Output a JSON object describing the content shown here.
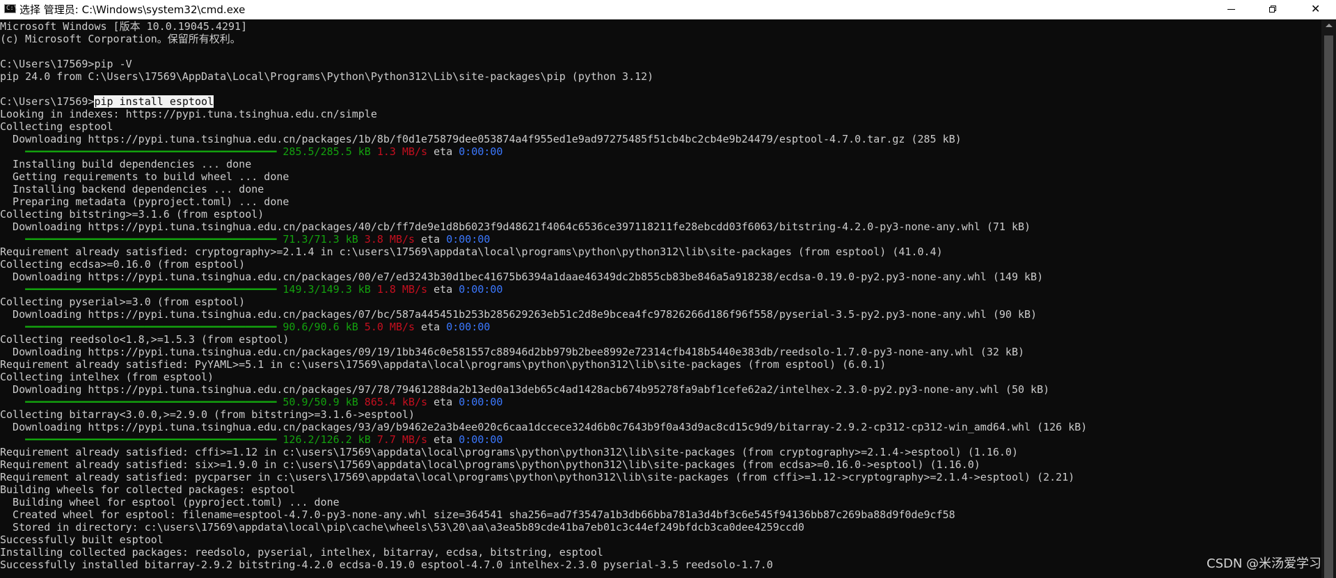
{
  "window": {
    "title": "选择 管理员: C:\\Windows\\system32\\cmd.exe",
    "minimize_glyph": "minimize-icon",
    "maximize_glyph": "restore-icon",
    "close_glyph": "✕"
  },
  "console": {
    "lines": [
      "Microsoft Windows [版本 10.0.19045.4291]",
      "(c) Microsoft Corporation。保留所有权利。",
      "",
      "C:\\Users\\17569>pip -V",
      "pip 24.0 from C:\\Users\\17569\\AppData\\Local\\Programs\\Python\\Python312\\Lib\\site-packages\\pip (python 3.12)",
      "",
      "",
      "Looking in indexes: https://pypi.tuna.tsinghua.edu.cn/simple",
      "Collecting esptool",
      "  Downloading https://pypi.tuna.tsinghua.edu.cn/packages/1b/8b/f0d1e75879dee053874a4f955ed1e9ad97275485f51cb4bc2cb4e9b24479/esptool-4.7.0.tar.gz (285 kB)",
      "",
      "  Installing build dependencies ... done",
      "  Getting requirements to build wheel ... done",
      "  Installing backend dependencies ... done",
      "  Preparing metadata (pyproject.toml) ... done",
      "Collecting bitstring>=3.1.6 (from esptool)",
      "  Downloading https://pypi.tuna.tsinghua.edu.cn/packages/40/cb/ff7de9e1d8b6023f9d48621f4064c6536ce397118211fe28ebcdd03f6063/bitstring-4.2.0-py3-none-any.whl (71 kB)",
      "",
      "Requirement already satisfied: cryptography>=2.1.4 in c:\\users\\17569\\appdata\\local\\programs\\python\\python312\\lib\\site-packages (from esptool) (41.0.4)",
      "Collecting ecdsa>=0.16.0 (from esptool)",
      "  Downloading https://pypi.tuna.tsinghua.edu.cn/packages/00/e7/ed3243b30d1bec41675b6394a1daae46349dc2b855cb83be846a5a918238/ecdsa-0.19.0-py2.py3-none-any.whl (149 kB)",
      "",
      "Collecting pyserial>=3.0 (from esptool)",
      "  Downloading https://pypi.tuna.tsinghua.edu.cn/packages/07/bc/587a445451b253b285629263eb51c2d8e9bcea4fc97826266d186f96f558/pyserial-3.5-py2.py3-none-any.whl (90 kB)",
      "",
      "Collecting reedsolo<1.8,>=1.5.3 (from esptool)",
      "  Downloading https://pypi.tuna.tsinghua.edu.cn/packages/09/19/1bb346c0e581557c88946d2bb979b2bee8992e72314cfb418b5440e383db/reedsolo-1.7.0-py3-none-any.whl (32 kB)",
      "Requirement already satisfied: PyYAML>=5.1 in c:\\users\\17569\\appdata\\local\\programs\\python\\python312\\lib\\site-packages (from esptool) (6.0.1)",
      "Collecting intelhex (from esptool)",
      "  Downloading https://pypi.tuna.tsinghua.edu.cn/packages/97/78/79461288da2b13ed0a13deb65c4ad1428acb674b95278fa9abf1cefe62a2/intelhex-2.3.0-py2.py3-none-any.whl (50 kB)",
      "",
      "Collecting bitarray<3.0.0,>=2.9.0 (from bitstring>=3.1.6->esptool)",
      "  Downloading https://pypi.tuna.tsinghua.edu.cn/packages/93/a9/b9462e2a3b4ee020c6caa1dccece324d6b0c7643b9f0a43d9ac8cd15c9d9/bitarray-2.9.2-cp312-cp312-win_amd64.whl (126 kB)",
      "",
      "Requirement already satisfied: cffi>=1.12 in c:\\users\\17569\\appdata\\local\\programs\\python\\python312\\lib\\site-packages (from cryptography>=2.1.4->esptool) (1.16.0)",
      "Requirement already satisfied: six>=1.9.0 in c:\\users\\17569\\appdata\\local\\programs\\python\\python312\\lib\\site-packages (from ecdsa>=0.16.0->esptool) (1.16.0)",
      "Requirement already satisfied: pycparser in c:\\users\\17569\\appdata\\local\\programs\\python\\python312\\lib\\site-packages (from cffi>=1.12->cryptography>=2.1.4->esptool) (2.21)",
      "Building wheels for collected packages: esptool",
      "  Building wheel for esptool (pyproject.toml) ... done",
      "  Created wheel for esptool: filename=esptool-4.7.0-py3-none-any.whl size=364541 sha256=ad7f3547a1b3db66bba781a3d4bf3c6e545f94136bb87c269ba88d9f0de9cf58",
      "  Stored in directory: c:\\users\\17569\\appdata\\local\\pip\\cache\\wheels\\53\\20\\aa\\a3ea5b89cde41ba7eb01c3c44ef249bfdcb3ca0dee4259ccd0",
      "Successfully built esptool",
      "Installing collected packages: reedsolo, pyserial, intelhex, bitarray, ecdsa, bitstring, esptool",
      "Successfully installed bitarray-2.9.2 bitstring-4.2.0 ecdsa-0.19.0 esptool-4.7.0 intelhex-2.3.0 pyserial-3.5 reedsolo-1.7.0"
    ],
    "command": {
      "prompt": "C:\\Users\\17569>",
      "selected": "pip install esptool"
    },
    "progress": [
      {
        "size": "285.5/285.5 kB",
        "speed": "1.3 MB/s",
        "eta_label": "eta",
        "eta": "0:00:00",
        "fraction": 1.0
      },
      {
        "size": "71.3/71.3 kB",
        "speed": "3.8 MB/s",
        "eta_label": "eta",
        "eta": "0:00:00",
        "fraction": 1.0
      },
      {
        "size": "149.3/149.3 kB",
        "speed": "1.8 MB/s",
        "eta_label": "eta",
        "eta": "0:00:00",
        "fraction": 1.0
      },
      {
        "size": "90.6/90.6 kB",
        "speed": "5.0 MB/s",
        "eta_label": "eta",
        "eta": "0:00:00",
        "fraction": 1.0
      },
      {
        "size": "50.9/50.9 kB",
        "speed": "865.4 kB/s",
        "eta_label": "eta",
        "eta": "0:00:00",
        "fraction": 1.0
      },
      {
        "size": "126.2/126.2 kB",
        "speed": "7.7 MB/s",
        "eta_label": "eta",
        "eta": "0:00:00",
        "fraction": 1.0
      }
    ],
    "progress_bar_text": "━━━━━━━━━━━━━━━━━━━━━━━━━━━━━━━━━━━━━━━━"
  },
  "watermark": "CSDN @米汤爱学习",
  "colors": {
    "background": "#0c0c0c",
    "text": "#cccccc",
    "green": "#13a10e",
    "red": "#c50f1f",
    "blue": "#3b78ff"
  }
}
